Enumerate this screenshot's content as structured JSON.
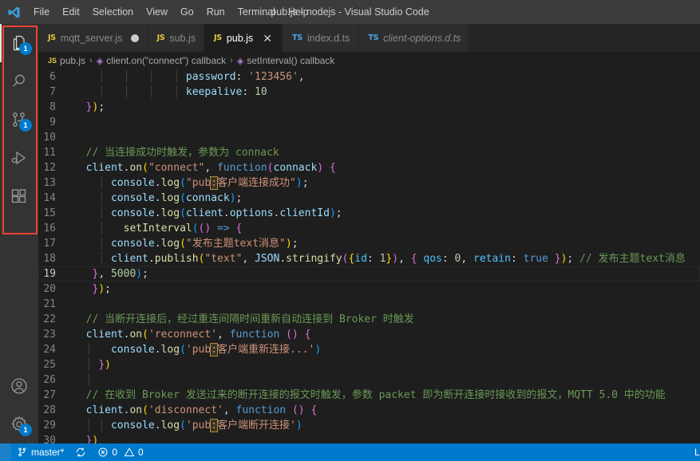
{
  "window": {
    "title": "pub.js - nodejs - Visual Studio Code",
    "logo_icon": "vscode-logo-icon"
  },
  "menubar": {
    "items": [
      {
        "label": "File"
      },
      {
        "label": "Edit"
      },
      {
        "label": "Selection"
      },
      {
        "label": "View"
      },
      {
        "label": "Go"
      },
      {
        "label": "Run"
      },
      {
        "label": "Terminal"
      },
      {
        "label": "Help"
      }
    ]
  },
  "activitybar": {
    "highlight_color": "#f4402f",
    "badge_color": "#007acc",
    "top_items": [
      {
        "name": "explorer",
        "icon": "files-icon",
        "badge": "1",
        "active": true
      },
      {
        "name": "search",
        "icon": "search-icon",
        "badge": "",
        "active": false
      },
      {
        "name": "source-control",
        "icon": "source-control-icon",
        "badge": "1",
        "active": false
      },
      {
        "name": "run-and-debug",
        "icon": "run-debug-icon",
        "badge": "",
        "active": false
      },
      {
        "name": "extensions",
        "icon": "extensions-icon",
        "badge": "",
        "active": false
      }
    ],
    "bottom_items": [
      {
        "name": "accounts",
        "icon": "account-icon",
        "badge": ""
      },
      {
        "name": "manage",
        "icon": "gear-icon",
        "badge": "1"
      }
    ]
  },
  "tabs": [
    {
      "label": "mqtt_server.js",
      "icon": "js",
      "active": false,
      "dirty": true,
      "italic": false,
      "closable": false
    },
    {
      "label": "sub.js",
      "icon": "js",
      "active": false,
      "dirty": false,
      "italic": false,
      "closable": false
    },
    {
      "label": "pub.js",
      "icon": "js",
      "active": true,
      "dirty": false,
      "italic": false,
      "closable": true
    },
    {
      "label": "index.d.ts",
      "icon": "ts",
      "active": false,
      "dirty": false,
      "italic": false,
      "closable": false
    },
    {
      "label": "client-options.d.ts",
      "icon": "ts",
      "active": false,
      "dirty": false,
      "italic": true,
      "closable": false
    }
  ],
  "breadcrumb": {
    "segments": [
      {
        "icon": "js-file-icon",
        "label": "pub.js"
      },
      {
        "icon": "symbol-cube-icon",
        "label": "client.on(\"connect\") callback"
      },
      {
        "icon": "symbol-cube-icon",
        "label": "setInterval() callback"
      }
    ],
    "separator": "›"
  },
  "editor": {
    "filename": "pub.js",
    "current_line": 19,
    "first_visible_line": 6,
    "lines": [
      {
        "n": "6",
        "segments": [
          {
            "t": "ind",
            "v": "    │   │   │   │ "
          },
          {
            "t": "var",
            "v": "password"
          },
          {
            "t": "plain",
            "v": ": "
          },
          {
            "t": "str",
            "v": "'123456'"
          },
          {
            "t": "plain",
            "v": ","
          }
        ]
      },
      {
        "n": "7",
        "segments": [
          {
            "t": "ind",
            "v": "    │   │   │   │ "
          },
          {
            "t": "var",
            "v": "keepalive"
          },
          {
            "t": "plain",
            "v": ": "
          },
          {
            "t": "num",
            "v": "10"
          }
        ]
      },
      {
        "n": "8",
        "segments": [
          {
            "t": "ind",
            "v": "  "
          },
          {
            "t": "par1",
            "v": "}"
          },
          {
            "t": "par0",
            "v": ")"
          },
          {
            "t": "plain",
            "v": ";"
          }
        ]
      },
      {
        "n": "9",
        "segments": [
          {
            "t": "plain",
            "v": ""
          }
        ]
      },
      {
        "n": "10",
        "segments": [
          {
            "t": "plain",
            "v": ""
          }
        ]
      },
      {
        "n": "11",
        "segments": [
          {
            "t": "ind",
            "v": "  "
          },
          {
            "t": "cmt",
            "v": "// 当连接成功时触发，参数为 connack"
          }
        ]
      },
      {
        "n": "12",
        "segments": [
          {
            "t": "ind",
            "v": "  "
          },
          {
            "t": "var",
            "v": "client"
          },
          {
            "t": "plain",
            "v": "."
          },
          {
            "t": "fn",
            "v": "on"
          },
          {
            "t": "par0",
            "v": "("
          },
          {
            "t": "str",
            "v": "\"connect\""
          },
          {
            "t": "plain",
            "v": ", "
          },
          {
            "t": "kw",
            "v": "function"
          },
          {
            "t": "par1",
            "v": "("
          },
          {
            "t": "var",
            "v": "connack"
          },
          {
            "t": "par1",
            "v": ")"
          },
          {
            "t": "plain",
            "v": " "
          },
          {
            "t": "par1",
            "v": "{"
          }
        ]
      },
      {
        "n": "13",
        "segments": [
          {
            "t": "ind",
            "v": "    │ "
          },
          {
            "t": "var",
            "v": "console"
          },
          {
            "t": "plain",
            "v": "."
          },
          {
            "t": "fn",
            "v": "log"
          },
          {
            "t": "par2",
            "v": "("
          },
          {
            "t": "str",
            "v": "\"pub"
          },
          {
            "t": "strhl",
            "v": ":"
          },
          {
            "t": "str",
            "v": "客户端连接成功\""
          },
          {
            "t": "par2",
            "v": ")"
          },
          {
            "t": "plain",
            "v": ";"
          }
        ]
      },
      {
        "n": "14",
        "segments": [
          {
            "t": "ind",
            "v": "    │ "
          },
          {
            "t": "var",
            "v": "console"
          },
          {
            "t": "plain",
            "v": "."
          },
          {
            "t": "fn",
            "v": "log"
          },
          {
            "t": "par2",
            "v": "("
          },
          {
            "t": "var",
            "v": "connack"
          },
          {
            "t": "par2",
            "v": ")"
          },
          {
            "t": "plain",
            "v": ";"
          }
        ]
      },
      {
        "n": "15",
        "segments": [
          {
            "t": "ind",
            "v": "    │ "
          },
          {
            "t": "var",
            "v": "console"
          },
          {
            "t": "plain",
            "v": "."
          },
          {
            "t": "fn",
            "v": "log"
          },
          {
            "t": "par2",
            "v": "("
          },
          {
            "t": "var",
            "v": "client"
          },
          {
            "t": "plain",
            "v": "."
          },
          {
            "t": "var",
            "v": "options"
          },
          {
            "t": "plain",
            "v": "."
          },
          {
            "t": "var",
            "v": "clientId"
          },
          {
            "t": "par2",
            "v": ")"
          },
          {
            "t": "plain",
            "v": ";"
          }
        ]
      },
      {
        "n": "16",
        "segments": [
          {
            "t": "ind",
            "v": "    │   "
          },
          {
            "t": "fn",
            "v": "setInterval"
          },
          {
            "t": "par2",
            "v": "("
          },
          {
            "t": "par1",
            "v": "()"
          },
          {
            "t": "plain",
            "v": " "
          },
          {
            "t": "kw",
            "v": "=>"
          },
          {
            "t": "plain",
            "v": " "
          },
          {
            "t": "par1",
            "v": "{"
          }
        ]
      },
      {
        "n": "17",
        "segments": [
          {
            "t": "ind",
            "v": "    │ "
          },
          {
            "t": "var",
            "v": "console"
          },
          {
            "t": "plain",
            "v": "."
          },
          {
            "t": "fn",
            "v": "log"
          },
          {
            "t": "par0",
            "v": "("
          },
          {
            "t": "str",
            "v": "\"发布主题text消息\""
          },
          {
            "t": "par0",
            "v": ")"
          },
          {
            "t": "plain",
            "v": ";"
          }
        ]
      },
      {
        "n": "18",
        "segments": [
          {
            "t": "ind",
            "v": "    │ "
          },
          {
            "t": "var",
            "v": "client"
          },
          {
            "t": "plain",
            "v": "."
          },
          {
            "t": "fn",
            "v": "publish"
          },
          {
            "t": "par0",
            "v": "("
          },
          {
            "t": "str",
            "v": "\"text\""
          },
          {
            "t": "plain",
            "v": ", "
          },
          {
            "t": "var",
            "v": "JSON"
          },
          {
            "t": "plain",
            "v": "."
          },
          {
            "t": "fn",
            "v": "stringify"
          },
          {
            "t": "par1",
            "v": "("
          },
          {
            "t": "par0",
            "v": "{"
          },
          {
            "t": "blue",
            "v": "id"
          },
          {
            "t": "plain",
            "v": ": "
          },
          {
            "t": "num",
            "v": "1"
          },
          {
            "t": "par0",
            "v": "}"
          },
          {
            "t": "par1",
            "v": ")"
          },
          {
            "t": "plain",
            "v": ", "
          },
          {
            "t": "par1",
            "v": "{"
          },
          {
            "t": "plain",
            "v": " "
          },
          {
            "t": "blue",
            "v": "qos"
          },
          {
            "t": "plain",
            "v": ": "
          },
          {
            "t": "num",
            "v": "0"
          },
          {
            "t": "plain",
            "v": ", "
          },
          {
            "t": "blue",
            "v": "retain"
          },
          {
            "t": "plain",
            "v": ": "
          },
          {
            "t": "kw",
            "v": "true"
          },
          {
            "t": "plain",
            "v": " "
          },
          {
            "t": "par1",
            "v": "}"
          },
          {
            "t": "par0",
            "v": ")"
          },
          {
            "t": "plain",
            "v": "; "
          },
          {
            "t": "cmt",
            "v": "// 发布主题text消息"
          }
        ]
      },
      {
        "n": "19",
        "segments": [
          {
            "t": "ind",
            "v": "   "
          },
          {
            "t": "par1",
            "v": "}"
          },
          {
            "t": "plain",
            "v": ", "
          },
          {
            "t": "num",
            "v": "5000"
          },
          {
            "t": "par2",
            "v": ")"
          },
          {
            "t": "plain",
            "v": ";"
          }
        ]
      },
      {
        "n": "20",
        "segments": [
          {
            "t": "ind",
            "v": "   "
          },
          {
            "t": "par1",
            "v": "}"
          },
          {
            "t": "par0",
            "v": ")"
          },
          {
            "t": "plain",
            "v": ";"
          }
        ]
      },
      {
        "n": "21",
        "segments": [
          {
            "t": "ind",
            "v": "  "
          }
        ]
      },
      {
        "n": "22",
        "segments": [
          {
            "t": "ind",
            "v": "  "
          },
          {
            "t": "cmt",
            "v": "// 当断开连接后，经过重连间隔时间重新自动连接到 Broker 时触发"
          }
        ]
      },
      {
        "n": "23",
        "segments": [
          {
            "t": "ind",
            "v": "  "
          },
          {
            "t": "var",
            "v": "client"
          },
          {
            "t": "plain",
            "v": "."
          },
          {
            "t": "fn",
            "v": "on"
          },
          {
            "t": "par0",
            "v": "("
          },
          {
            "t": "str",
            "v": "'reconnect'"
          },
          {
            "t": "plain",
            "v": ", "
          },
          {
            "t": "kw",
            "v": "function"
          },
          {
            "t": "plain",
            "v": " "
          },
          {
            "t": "par1",
            "v": "()"
          },
          {
            "t": "plain",
            "v": " "
          },
          {
            "t": "par1",
            "v": "{"
          }
        ]
      },
      {
        "n": "24",
        "segments": [
          {
            "t": "ind",
            "v": "  │   "
          },
          {
            "t": "var",
            "v": "console"
          },
          {
            "t": "plain",
            "v": "."
          },
          {
            "t": "fn",
            "v": "log"
          },
          {
            "t": "par2",
            "v": "("
          },
          {
            "t": "str",
            "v": "'pub"
          },
          {
            "t": "strhl",
            "v": ":"
          },
          {
            "t": "str",
            "v": "客户端重新连接...'"
          },
          {
            "t": "par2",
            "v": ")"
          }
        ]
      },
      {
        "n": "25",
        "segments": [
          {
            "t": "ind",
            "v": "  │ "
          },
          {
            "t": "par1",
            "v": "}"
          },
          {
            "t": "par0",
            "v": ")"
          }
        ]
      },
      {
        "n": "26",
        "segments": [
          {
            "t": "ind",
            "v": "  │ "
          }
        ]
      },
      {
        "n": "27",
        "segments": [
          {
            "t": "ind",
            "v": "  "
          },
          {
            "t": "cmt",
            "v": "// 在收到 Broker 发送过来的断开连接的报文时触发，参数 packet 即为断开连接时接收到的报文，MQTT 5.0 中的功能"
          }
        ]
      },
      {
        "n": "28",
        "segments": [
          {
            "t": "ind",
            "v": "  "
          },
          {
            "t": "var",
            "v": "client"
          },
          {
            "t": "plain",
            "v": "."
          },
          {
            "t": "fn",
            "v": "on"
          },
          {
            "t": "par0",
            "v": "("
          },
          {
            "t": "str",
            "v": "'disconnect'"
          },
          {
            "t": "plain",
            "v": ", "
          },
          {
            "t": "kw",
            "v": "function"
          },
          {
            "t": "plain",
            "v": " "
          },
          {
            "t": "par1",
            "v": "()"
          },
          {
            "t": "plain",
            "v": " "
          },
          {
            "t": "par1",
            "v": "{"
          }
        ]
      },
      {
        "n": "29",
        "segments": [
          {
            "t": "ind",
            "v": "  │ │ "
          },
          {
            "t": "var",
            "v": "console"
          },
          {
            "t": "plain",
            "v": "."
          },
          {
            "t": "fn",
            "v": "log"
          },
          {
            "t": "par2",
            "v": "("
          },
          {
            "t": "str",
            "v": "'pub"
          },
          {
            "t": "strhl",
            "v": ":"
          },
          {
            "t": "str",
            "v": "客户端断开连接'"
          },
          {
            "t": "par2",
            "v": ")"
          }
        ]
      },
      {
        "n": "30",
        "segments": [
          {
            "t": "ind",
            "v": "  "
          },
          {
            "t": "par1",
            "v": "}"
          },
          {
            "t": "par0",
            "v": ")"
          }
        ]
      }
    ]
  },
  "statusbar": {
    "background": "#007acc",
    "remote_icon": "remote-window-icon",
    "branch": "master*",
    "branch_icon": "source-control-icon",
    "sync_icon": "sync-icon",
    "errors": "0",
    "warnings": "0",
    "error_icon": "error-icon",
    "warning_icon": "warning-icon"
  }
}
